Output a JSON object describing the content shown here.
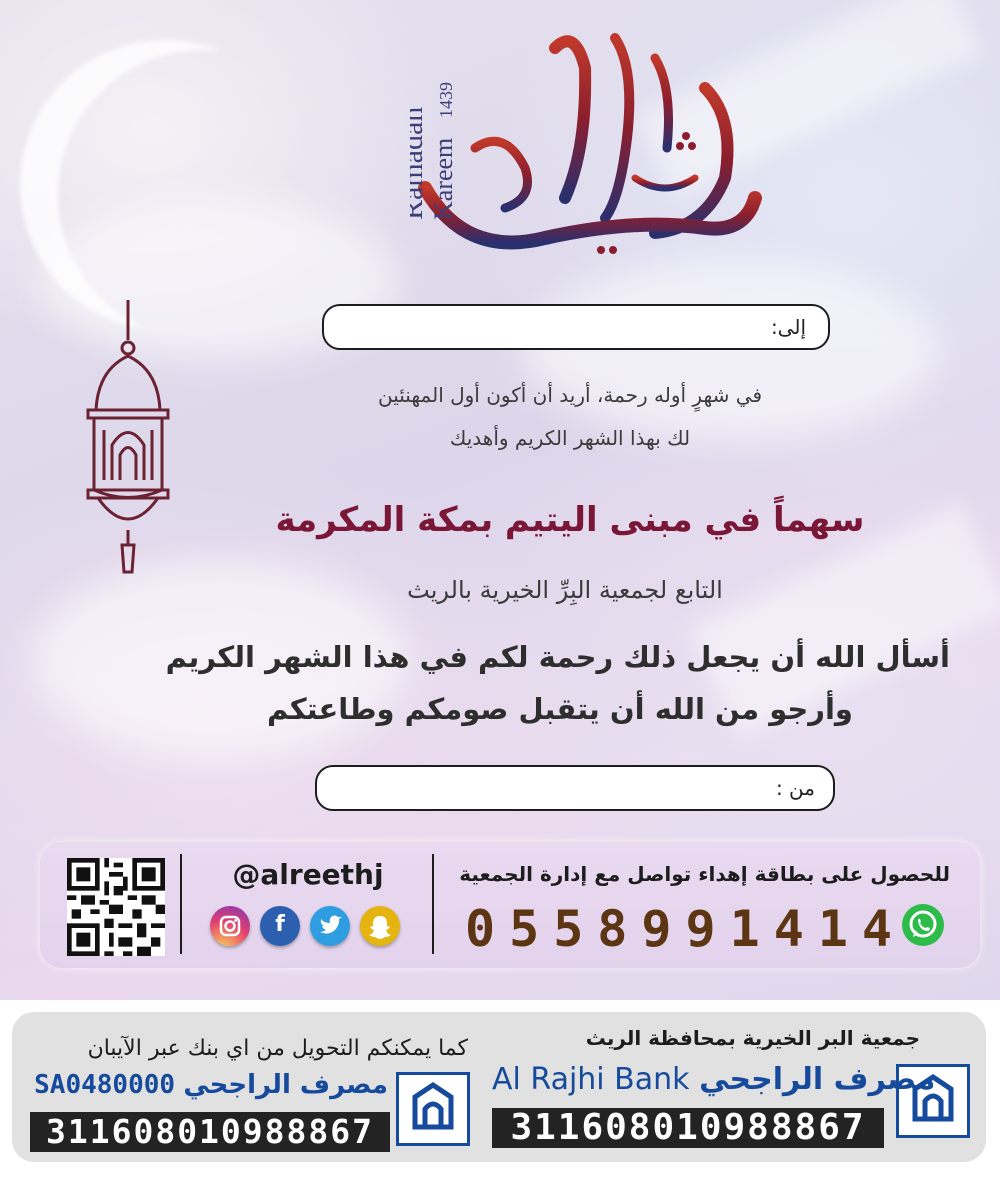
{
  "brand": {
    "arabic_logo": "الخير شهر",
    "latin_line1": "Ramadan",
    "latin_line2": "Kareem",
    "year": "1439",
    "logo_colors": [
      "#8a1e2e",
      "#2a2f6e"
    ]
  },
  "form": {
    "to_label": "إلى:",
    "from_label": "من :"
  },
  "message": {
    "intro_line1": "في شهرٍ أوله رحمة، أريد أن أكون أول المهنئين",
    "intro_line2": "لك بهذا الشهر الكريم وأهديك",
    "headline": "سهماً في مبنى اليتيم بمكة المكرمة",
    "subline": "التابع لجمعية البِرِّ الخيرية بالريث",
    "prayer_line1": "أسأل الله أن يجعل ذلك رحمة لكم في هذا الشهر الكريم",
    "prayer_line2": "وأرجو من الله أن يتقبل صومكم وطاعتكم"
  },
  "contact": {
    "cta": "للحصول على بطاقة إهداء  تواصل مع إدارة الجمعية",
    "phone": "0558991414",
    "handle": "@alreethj",
    "social_icons": [
      "instagram-icon",
      "facebook-icon",
      "twitter-icon",
      "snapchat-icon"
    ],
    "whatsapp_icon": "whatsapp-icon",
    "accent_color": "#5c3513"
  },
  "bank": {
    "org_name": "جمعية  البر الخيرية بمحافظة الريث",
    "bank_name_ar": "مصرف الراجحي",
    "bank_name_en": "Al Rajhi Bank",
    "account_number": "311608010988867",
    "iban_note": "كما يمكنكم التحويل من اي بنك عبر الآيبان",
    "iban_bank_name_ar": "مصرف الراجحي",
    "iban": "SA0480000",
    "iban_account": "311608010988867",
    "brand_color": "#164a9c"
  }
}
